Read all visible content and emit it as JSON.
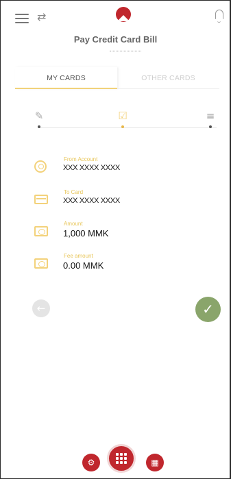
{
  "header": {
    "title": "Pay Credit Card Bill",
    "icons": [
      "menu-icon",
      "language-icon",
      "logo",
      "bell-icon"
    ]
  },
  "tabs": [
    {
      "label": "MY CARDS",
      "active": true
    },
    {
      "label": "OTHER CARDS",
      "active": false
    }
  ],
  "stepper": {
    "steps": [
      {
        "icon": "pencil-icon",
        "glyph": "✎",
        "state": "done"
      },
      {
        "icon": "check-circle-icon",
        "glyph": "☑",
        "state": "current"
      },
      {
        "icon": "checklist-icon",
        "glyph": "≡",
        "state": "pending"
      }
    ]
  },
  "details": [
    {
      "icon": "account-icon",
      "label": "From Account",
      "value": "XXX XXXX XXXX"
    },
    {
      "icon": "card-icon",
      "label": "To Card",
      "value": "XXX XXXX XXXX"
    },
    {
      "icon": "money-icon",
      "label": "Amount",
      "value": "1,000 MMK"
    },
    {
      "icon": "money-icon",
      "label": "Fee amount",
      "value": "0.00 MMK"
    }
  ],
  "actions": {
    "back_glyph": "←",
    "confirm_glyph": "✓"
  },
  "bottom_nav": {
    "left_glyph": "⚙",
    "main_icon": "grid-icon",
    "right_glyph": "▦"
  },
  "colors": {
    "brand_red": "#c0272d",
    "accent_gold": "#f3d27b",
    "confirm_green": "#8aa56b"
  }
}
